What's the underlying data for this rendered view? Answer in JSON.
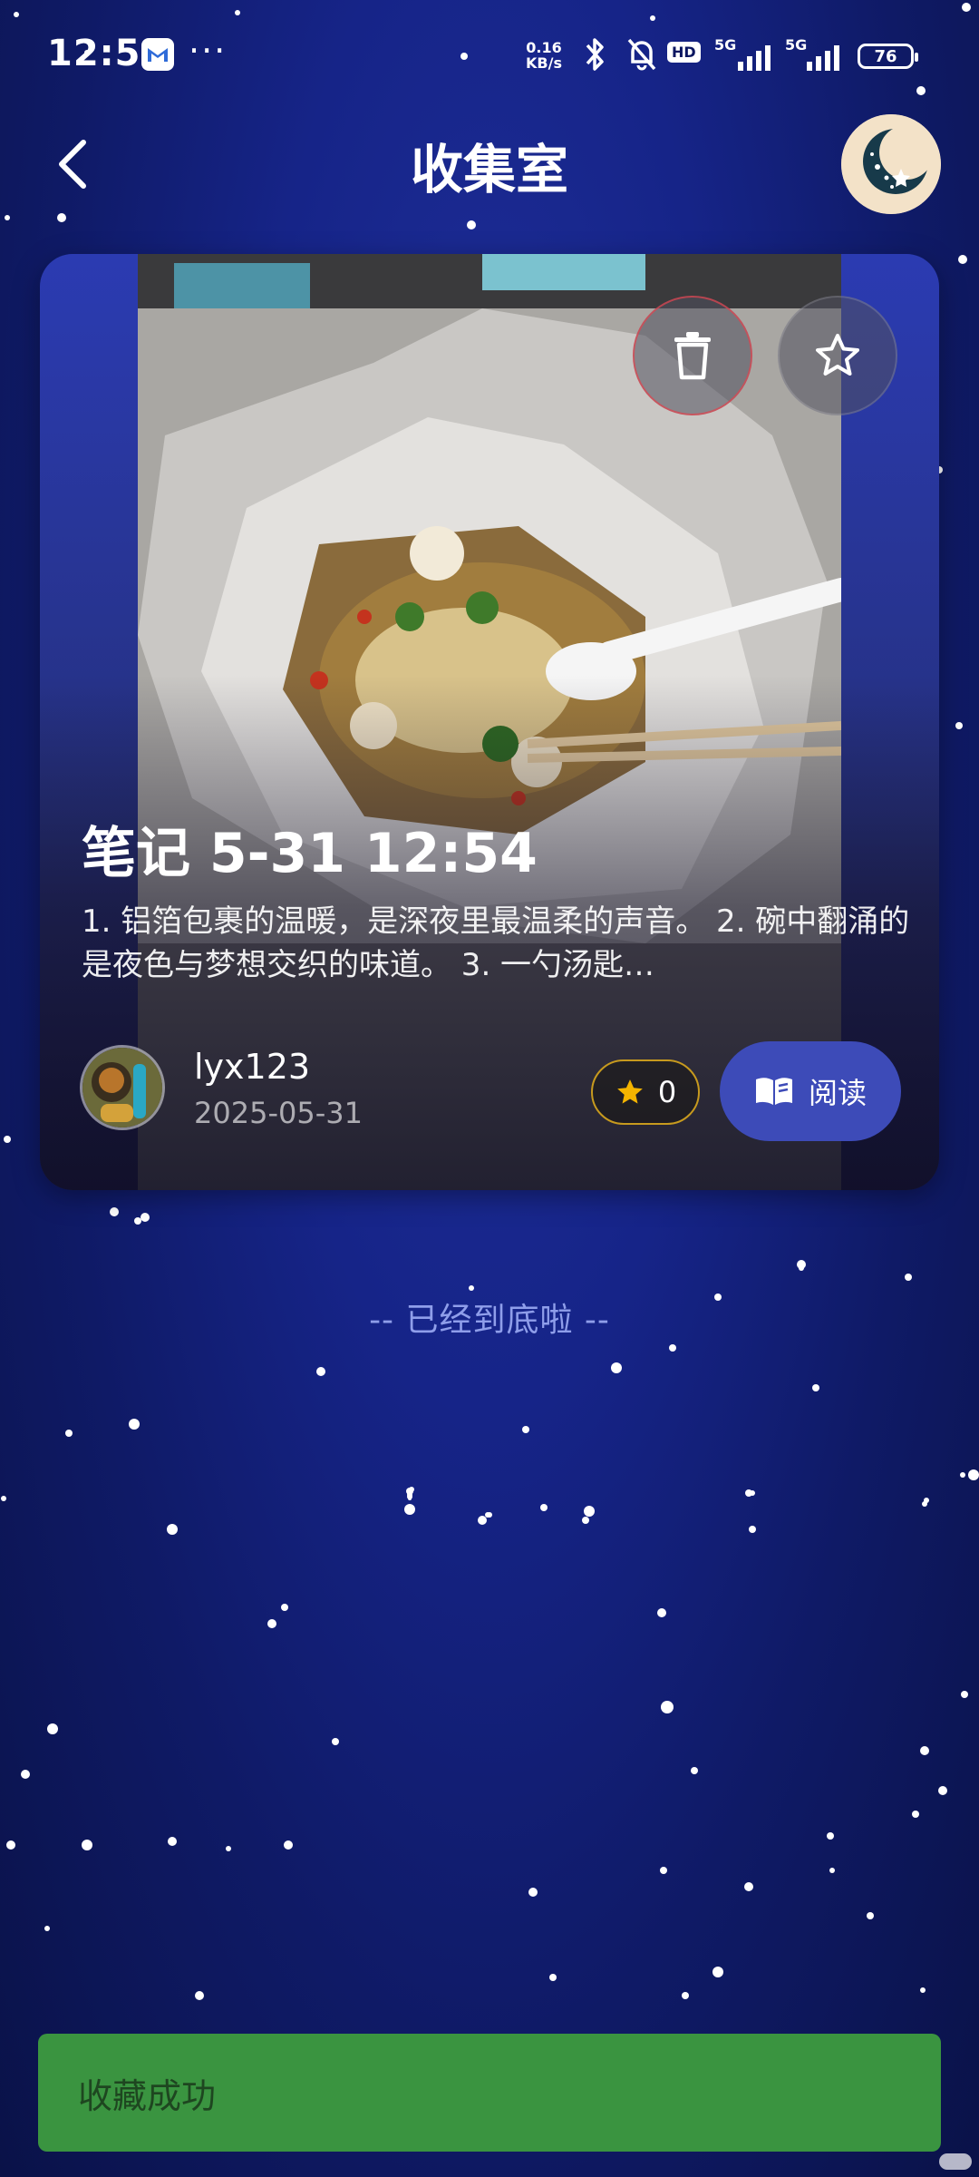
{
  "status_bar": {
    "time": "12:51",
    "more": "···",
    "net_speed_value": "0.16",
    "net_speed_unit": "KB/s",
    "hd_label": "HD",
    "sig1_label": "5G",
    "sig2_label": "5G",
    "battery": "76",
    "icons": [
      "mail-icon",
      "bluetooth-icon",
      "mute-icon",
      "hd-icon",
      "signal-icon",
      "battery-icon"
    ]
  },
  "header": {
    "title": "收集室"
  },
  "card": {
    "title": "笔记 5-31 12:54",
    "description": "1. 铝箔包裹的温暖，是深夜里最温柔的声音。 2. 碗中翻涌的是夜色与梦想交织的味道。 3. 一勺汤匙…",
    "author_name": "lyx123",
    "date": "2025-05-31",
    "like_count": "0",
    "read_label": "阅读"
  },
  "footer": {
    "end_text": "-- 已经到底啦 --"
  },
  "toast": {
    "message": "收藏成功"
  },
  "colors": {
    "background": "#162488",
    "read_button": "#3d4bb8",
    "toast": "#3a9440",
    "star_gold": "#f4b400"
  }
}
